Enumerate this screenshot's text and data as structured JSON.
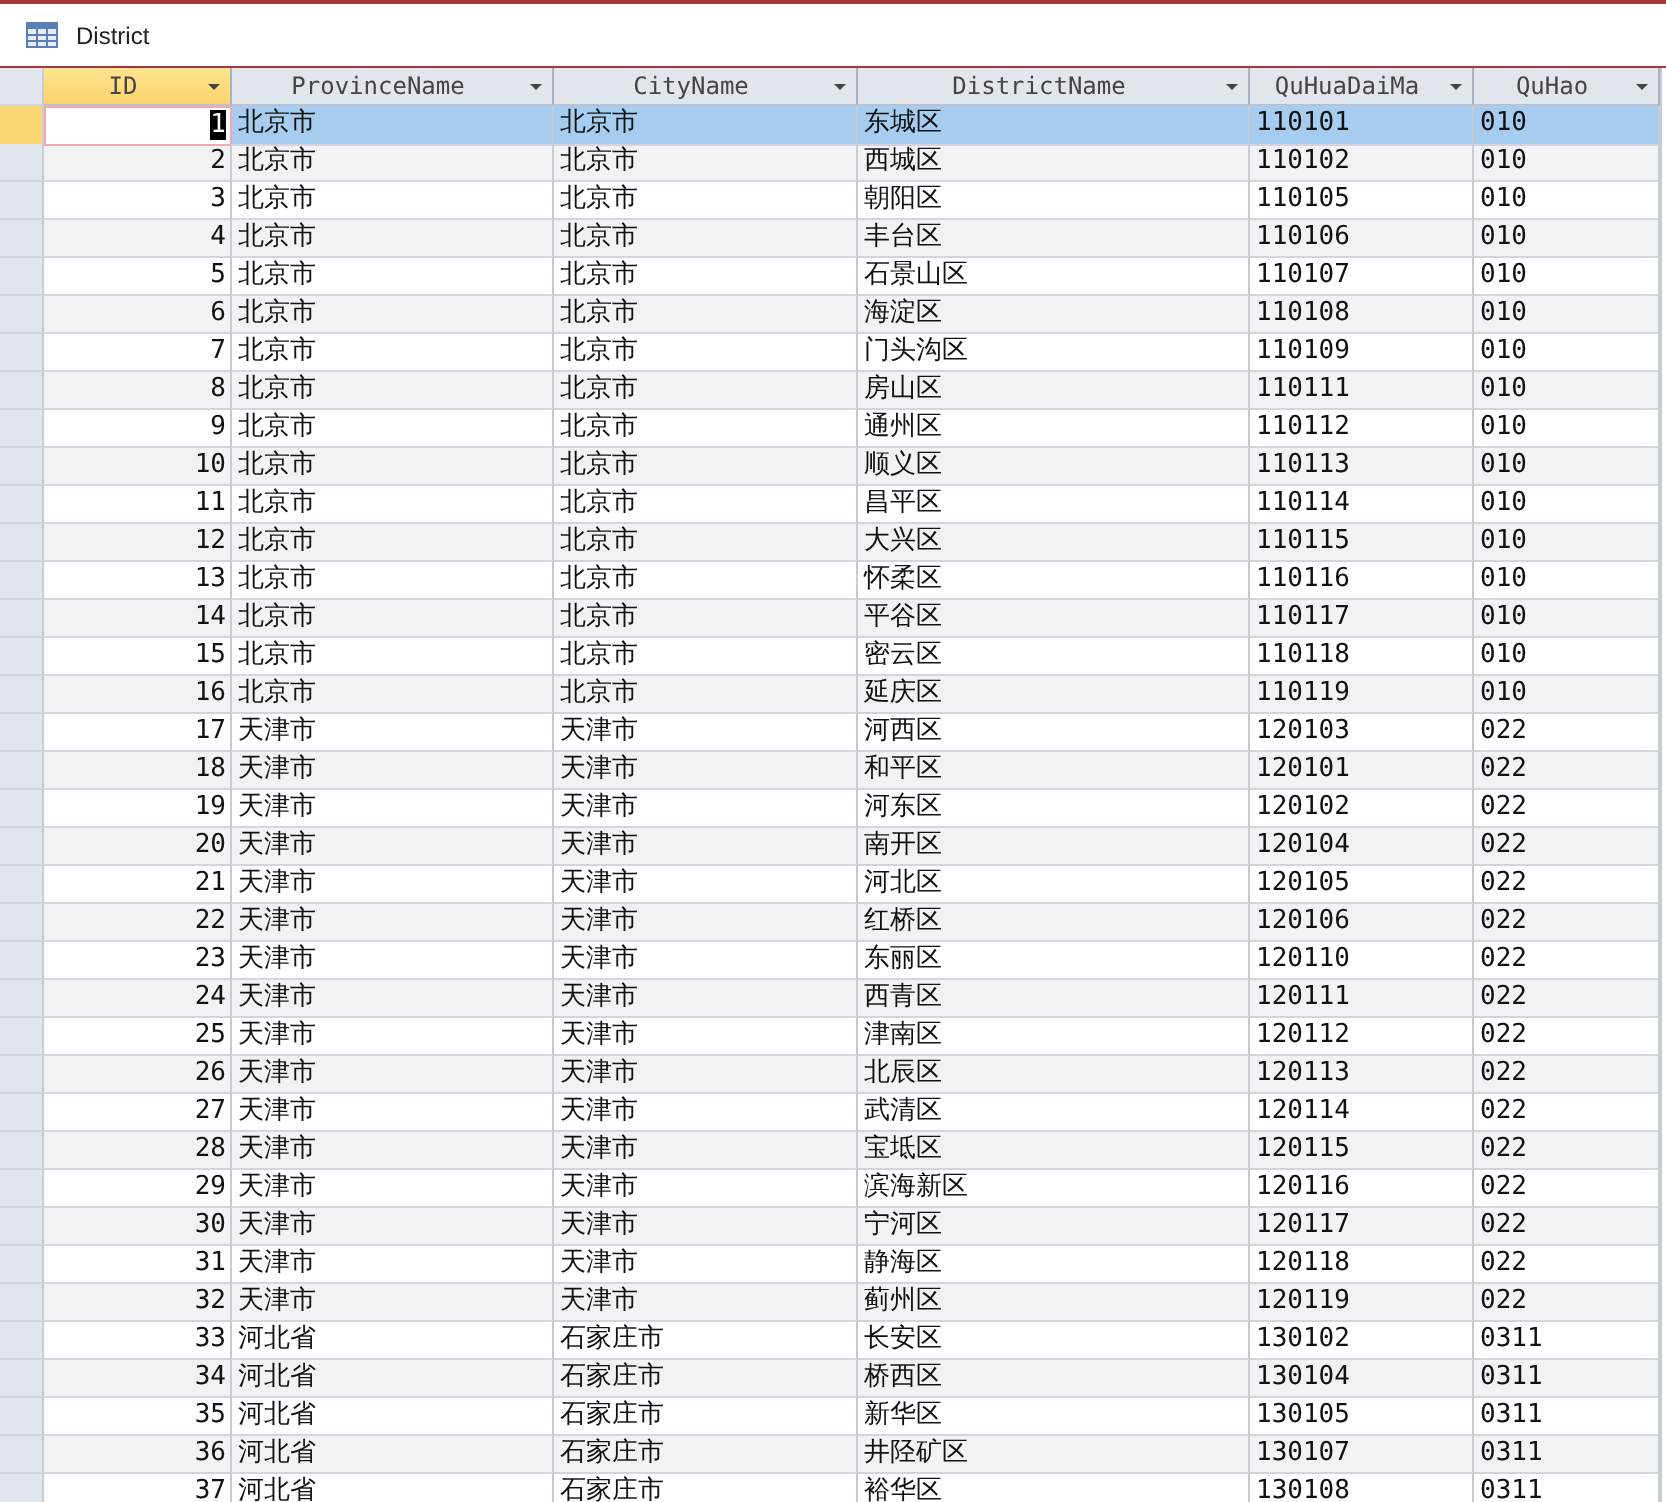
{
  "window": {
    "title": "District"
  },
  "table": {
    "columns": [
      "ID",
      "ProvinceName",
      "CityName",
      "DistrictName",
      "QuHuaDaiMa",
      "QuHao"
    ],
    "rows": [
      {
        "selected": true,
        "cells": [
          "1",
          "北京市",
          "北京市",
          "东城区",
          "110101",
          "010"
        ]
      },
      {
        "selected": false,
        "cells": [
          "2",
          "北京市",
          "北京市",
          "西城区",
          "110102",
          "010"
        ]
      },
      {
        "selected": false,
        "cells": [
          "3",
          "北京市",
          "北京市",
          "朝阳区",
          "110105",
          "010"
        ]
      },
      {
        "selected": false,
        "cells": [
          "4",
          "北京市",
          "北京市",
          "丰台区",
          "110106",
          "010"
        ]
      },
      {
        "selected": false,
        "cells": [
          "5",
          "北京市",
          "北京市",
          "石景山区",
          "110107",
          "010"
        ]
      },
      {
        "selected": false,
        "cells": [
          "6",
          "北京市",
          "北京市",
          "海淀区",
          "110108",
          "010"
        ]
      },
      {
        "selected": false,
        "cells": [
          "7",
          "北京市",
          "北京市",
          "门头沟区",
          "110109",
          "010"
        ]
      },
      {
        "selected": false,
        "cells": [
          "8",
          "北京市",
          "北京市",
          "房山区",
          "110111",
          "010"
        ]
      },
      {
        "selected": false,
        "cells": [
          "9",
          "北京市",
          "北京市",
          "通州区",
          "110112",
          "010"
        ]
      },
      {
        "selected": false,
        "cells": [
          "10",
          "北京市",
          "北京市",
          "顺义区",
          "110113",
          "010"
        ]
      },
      {
        "selected": false,
        "cells": [
          "11",
          "北京市",
          "北京市",
          "昌平区",
          "110114",
          "010"
        ]
      },
      {
        "selected": false,
        "cells": [
          "12",
          "北京市",
          "北京市",
          "大兴区",
          "110115",
          "010"
        ]
      },
      {
        "selected": false,
        "cells": [
          "13",
          "北京市",
          "北京市",
          "怀柔区",
          "110116",
          "010"
        ]
      },
      {
        "selected": false,
        "cells": [
          "14",
          "北京市",
          "北京市",
          "平谷区",
          "110117",
          "010"
        ]
      },
      {
        "selected": false,
        "cells": [
          "15",
          "北京市",
          "北京市",
          "密云区",
          "110118",
          "010"
        ]
      },
      {
        "selected": false,
        "cells": [
          "16",
          "北京市",
          "北京市",
          "延庆区",
          "110119",
          "010"
        ]
      },
      {
        "selected": false,
        "cells": [
          "17",
          "天津市",
          "天津市",
          "河西区",
          "120103",
          "022"
        ]
      },
      {
        "selected": false,
        "cells": [
          "18",
          "天津市",
          "天津市",
          "和平区",
          "120101",
          "022"
        ]
      },
      {
        "selected": false,
        "cells": [
          "19",
          "天津市",
          "天津市",
          "河东区",
          "120102",
          "022"
        ]
      },
      {
        "selected": false,
        "cells": [
          "20",
          "天津市",
          "天津市",
          "南开区",
          "120104",
          "022"
        ]
      },
      {
        "selected": false,
        "cells": [
          "21",
          "天津市",
          "天津市",
          "河北区",
          "120105",
          "022"
        ]
      },
      {
        "selected": false,
        "cells": [
          "22",
          "天津市",
          "天津市",
          "红桥区",
          "120106",
          "022"
        ]
      },
      {
        "selected": false,
        "cells": [
          "23",
          "天津市",
          "天津市",
          "东丽区",
          "120110",
          "022"
        ]
      },
      {
        "selected": false,
        "cells": [
          "24",
          "天津市",
          "天津市",
          "西青区",
          "120111",
          "022"
        ]
      },
      {
        "selected": false,
        "cells": [
          "25",
          "天津市",
          "天津市",
          "津南区",
          "120112",
          "022"
        ]
      },
      {
        "selected": false,
        "cells": [
          "26",
          "天津市",
          "天津市",
          "北辰区",
          "120113",
          "022"
        ]
      },
      {
        "selected": false,
        "cells": [
          "27",
          "天津市",
          "天津市",
          "武清区",
          "120114",
          "022"
        ]
      },
      {
        "selected": false,
        "cells": [
          "28",
          "天津市",
          "天津市",
          "宝坻区",
          "120115",
          "022"
        ]
      },
      {
        "selected": false,
        "cells": [
          "29",
          "天津市",
          "天津市",
          "滨海新区",
          "120116",
          "022"
        ]
      },
      {
        "selected": false,
        "cells": [
          "30",
          "天津市",
          "天津市",
          "宁河区",
          "120117",
          "022"
        ]
      },
      {
        "selected": false,
        "cells": [
          "31",
          "天津市",
          "天津市",
          "静海区",
          "120118",
          "022"
        ]
      },
      {
        "selected": false,
        "cells": [
          "32",
          "天津市",
          "天津市",
          "蓟州区",
          "120119",
          "022"
        ]
      },
      {
        "selected": false,
        "cells": [
          "33",
          "河北省",
          "石家庄市",
          "长安区",
          "130102",
          "0311"
        ]
      },
      {
        "selected": false,
        "cells": [
          "34",
          "河北省",
          "石家庄市",
          "桥西区",
          "130104",
          "0311"
        ]
      },
      {
        "selected": false,
        "cells": [
          "35",
          "河北省",
          "石家庄市",
          "新华区",
          "130105",
          "0311"
        ]
      },
      {
        "selected": false,
        "cells": [
          "36",
          "河北省",
          "石家庄市",
          "井陉矿区",
          "130107",
          "0311"
        ]
      },
      {
        "selected": false,
        "cells": [
          "37",
          "河北省",
          "石家庄市",
          "裕华区",
          "130108",
          "0311"
        ]
      }
    ]
  }
}
